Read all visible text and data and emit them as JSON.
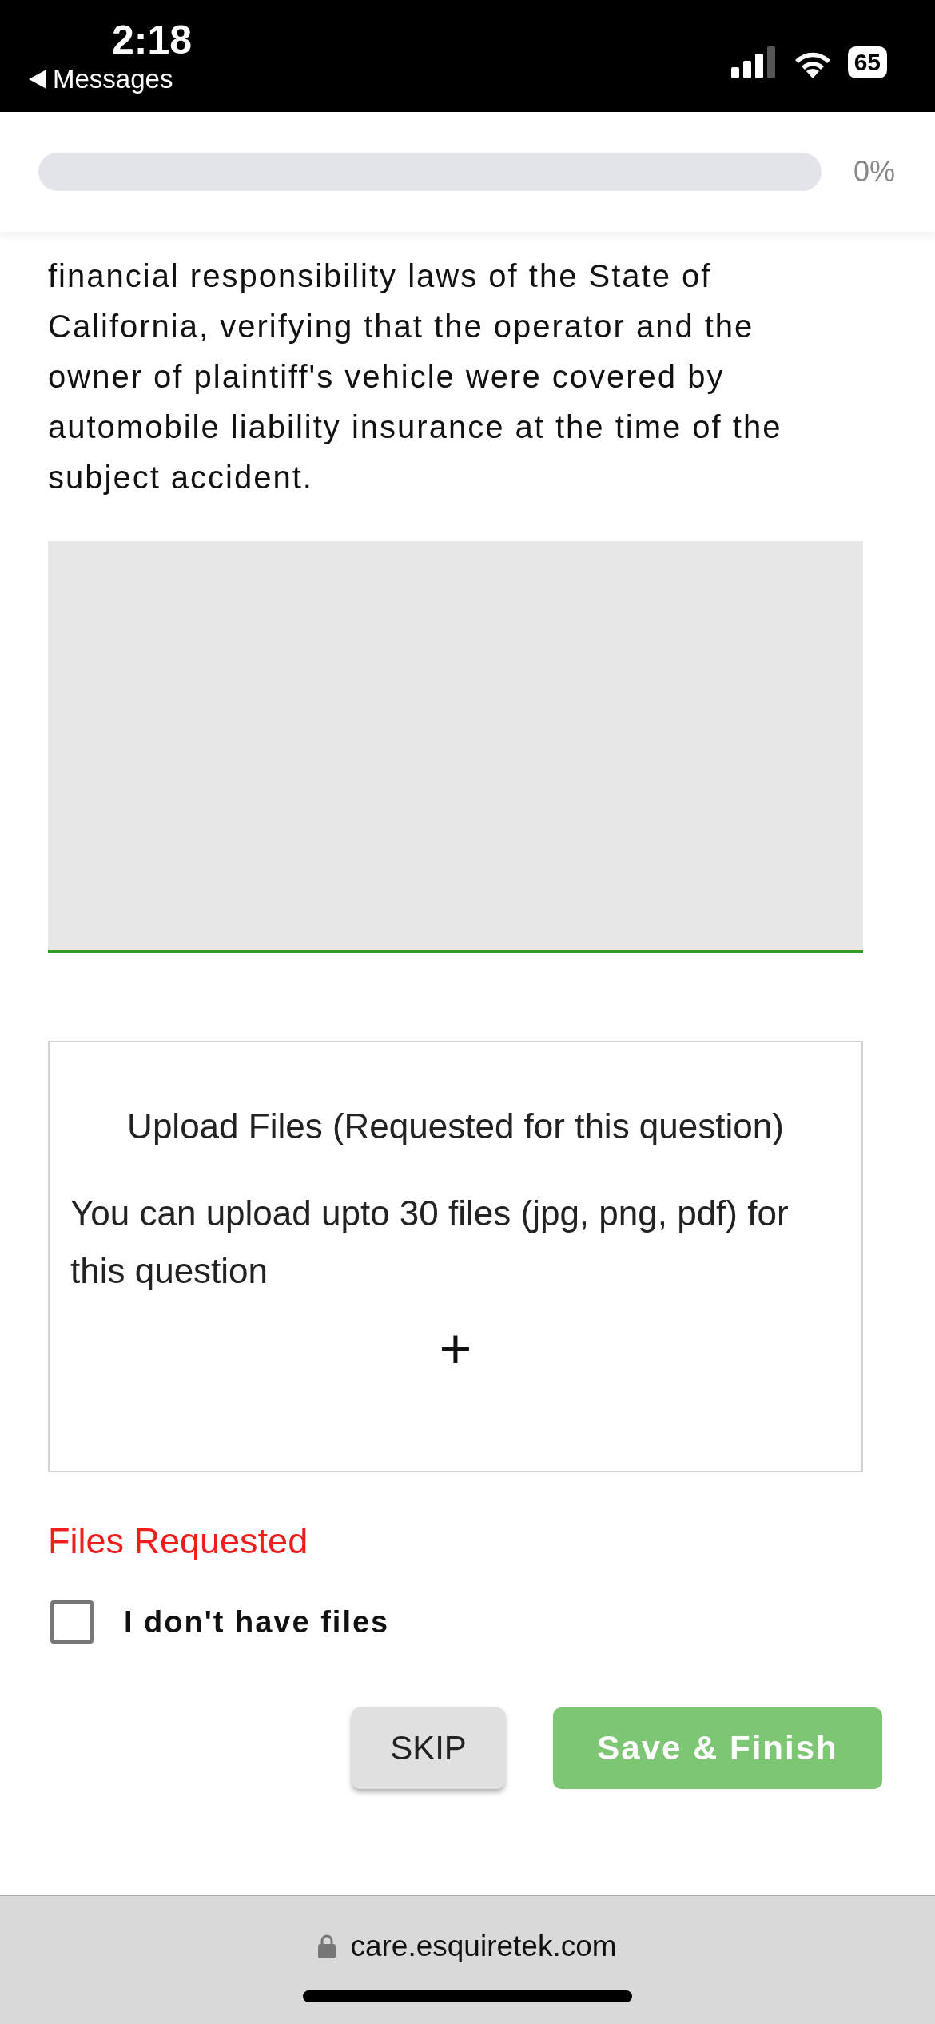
{
  "status_bar": {
    "time": "2:18",
    "back_label": "Messages",
    "battery": "65"
  },
  "progress": {
    "level": 0,
    "reading": "0%"
  },
  "question": {
    "text": "financial responsibility laws of the State of California, verifying that the operator and the owner of plaintiff's vehicle were covered by automobile liability insurance at the time of the subject accident."
  },
  "upload": {
    "title": "Upload Files (Requested for this question)",
    "hint": "You can upload upto 30 files (jpg, png, pdf) for this question",
    "add": "+"
  },
  "error": "Files Requested",
  "no_files": {
    "label": "I don't have files",
    "checked": false
  },
  "buttons": [
    {
      "kind": "secondary",
      "label": "SKIP"
    },
    {
      "kind": "primary",
      "label": "Save & Finish"
    }
  ],
  "browser": {
    "url": "care.esquiretek.com"
  }
}
